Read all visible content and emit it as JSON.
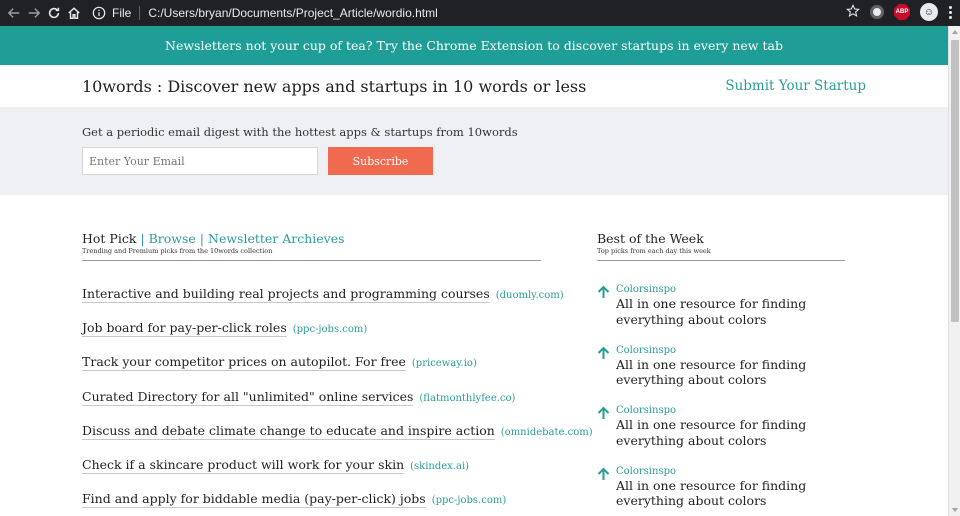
{
  "browser": {
    "scheme": "File",
    "url": "C:/Users/bryan/Documents/Project_Article/wordio.html",
    "abp_label": "ABP"
  },
  "banner": {
    "text": "Newsletters not your cup of tea? Try the Chrome Extension to discover startups in every new tab"
  },
  "header": {
    "title": "10words : Discover new apps and startups in 10 words or less",
    "submit_link": "Submit Your Startup"
  },
  "newsletter": {
    "prompt": "Get a periodic email digest with the hottest apps & startups from 10words",
    "email_placeholder": "Enter Your Email",
    "subscribe_label": "Subscribe"
  },
  "hot_pick": {
    "tabs": {
      "hot_pick": "Hot Pick",
      "separator": "|",
      "browse": "Browse",
      "archives": "Newsletter Archieves"
    },
    "subtitle": "Trending and Premium picks from the 10words collection",
    "items": [
      {
        "text": "Interactive and building real projects and programming courses",
        "domain": "(duomly.com)"
      },
      {
        "text": "Job board for pay-per-click roles",
        "domain": "(ppc-jobs.com)"
      },
      {
        "text": "Track your competitor prices on autopilot. For free",
        "domain": "(priceway.io)"
      },
      {
        "text": "Curated Directory for all \"unlimited\" online services",
        "domain": "(flatmonthlyfee.co)"
      },
      {
        "text": "Discuss and debate climate change to educate and inspire action",
        "domain": "(omnidebate.com)"
      },
      {
        "text": "Check if a skincare product will work for your skin",
        "domain": "(skindex.ai)"
      },
      {
        "text": "Find and apply for biddable media (pay-per-click) jobs",
        "domain": "(ppc-jobs.com)"
      }
    ]
  },
  "best_of_week": {
    "title": "Best of the Week",
    "subtitle": "Top picks from each day this week",
    "items": [
      {
        "name": "Colorsinspo",
        "text": "All in one resource for finding everything about colors"
      },
      {
        "name": "Colorsinspo",
        "text": "All in one resource for finding everything about colors"
      },
      {
        "name": "Colorsinspo",
        "text": "All in one resource for finding everything about colors"
      },
      {
        "name": "Colorsinspo",
        "text": "All in one resource for finding everything about colors"
      }
    ]
  },
  "colors": {
    "accent": "#1f9e97",
    "link": "#2a9d96",
    "subscribe": "#ef6a4f",
    "newsletter_bg": "#eef0f3"
  },
  "icons": {
    "back": "back-arrow-icon",
    "forward": "forward-arrow-icon",
    "reload": "reload-icon",
    "home": "home-icon",
    "info": "info-icon",
    "bookmark": "star-icon",
    "upvote": "arrow-up-icon"
  }
}
